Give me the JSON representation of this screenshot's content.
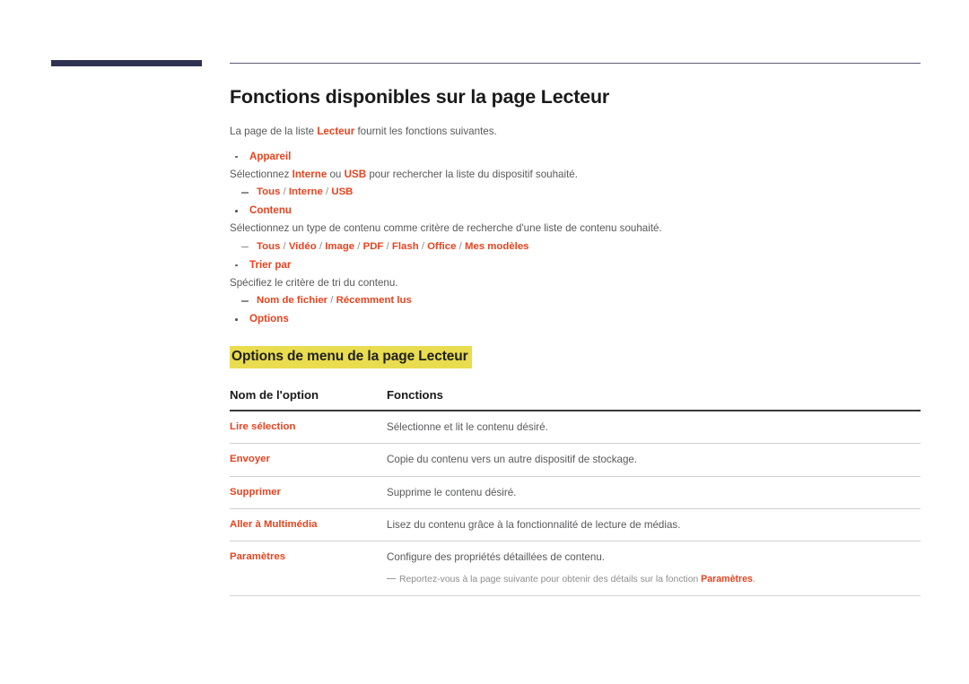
{
  "page": {
    "title": "Fonctions disponibles sur la page Lecteur",
    "intro": {
      "before": "La page de la liste ",
      "accent": "Lecteur",
      "after": " fournit les fonctions suivantes."
    }
  },
  "colors": {
    "accent": "#e8431f",
    "body_text": "#58595b",
    "heading": "#1a1a1a",
    "highlight": "#e9dc4e",
    "navy_bar": "#2e3250",
    "rule": "#5a5a72",
    "table_header_rule": "#3a3a3a",
    "table_row_rule": "#cfcfcf",
    "muted": "#8d8d8d"
  },
  "bullets": [
    {
      "label": "Appareil",
      "description_parts": [
        {
          "text": "Sélectionnez ",
          "style": "plain"
        },
        {
          "text": "Interne",
          "style": "accent"
        },
        {
          "text": " ou ",
          "style": "plain"
        },
        {
          "text": "USB",
          "style": "accent"
        },
        {
          "text": " pour rechercher la liste du dispositif souhaité.",
          "style": "plain"
        }
      ],
      "sub_items": [
        {
          "parts": [
            {
              "text": "Tous",
              "style": "accent"
            },
            {
              "text": " / ",
              "style": "sep"
            },
            {
              "text": "Interne",
              "style": "accent"
            },
            {
              "text": " / ",
              "style": "sep"
            },
            {
              "text": "USB",
              "style": "accent"
            }
          ]
        }
      ]
    },
    {
      "label": "Contenu",
      "description_parts": [
        {
          "text": "Sélectionnez un type de contenu comme critère de recherche d'une liste de contenu souhaité.",
          "style": "plain"
        }
      ],
      "sub_items": [
        {
          "parts": [
            {
              "text": "Tous",
              "style": "accent"
            },
            {
              "text": " / ",
              "style": "sep"
            },
            {
              "text": "Vidéo",
              "style": "accent"
            },
            {
              "text": " / ",
              "style": "sep"
            },
            {
              "text": "Image",
              "style": "accent"
            },
            {
              "text": " / ",
              "style": "sep"
            },
            {
              "text": "PDF",
              "style": "accent"
            },
            {
              "text": " / ",
              "style": "sep"
            },
            {
              "text": "Flash",
              "style": "accent"
            },
            {
              "text": " / ",
              "style": "sep"
            },
            {
              "text": "Office",
              "style": "accent"
            },
            {
              "text": " / ",
              "style": "sep"
            },
            {
              "text": "Mes modèles",
              "style": "accent"
            }
          ]
        }
      ]
    },
    {
      "label": "Trier par",
      "description_parts": [
        {
          "text": "Spécifiez le critère de tri du contenu.",
          "style": "plain"
        }
      ],
      "sub_items": [
        {
          "parts": [
            {
              "text": "Nom de fichier",
              "style": "accent"
            },
            {
              "text": " / ",
              "style": "sep"
            },
            {
              "text": "Récemment lus",
              "style": "accent"
            }
          ]
        }
      ]
    },
    {
      "label": "Options",
      "description_parts": [],
      "sub_items": []
    }
  ],
  "section": {
    "heading": "Options de menu de la page Lecteur"
  },
  "table": {
    "headers": [
      "Nom de l'option",
      "Fonctions"
    ],
    "rows": [
      {
        "name": "Lire sélection",
        "function": "Sélectionne et lit le contenu désiré.",
        "note": null
      },
      {
        "name": "Envoyer",
        "function": "Copie du contenu vers un autre dispositif de stockage.",
        "note": null
      },
      {
        "name": "Supprimer",
        "function": "Supprime le contenu désiré.",
        "note": null
      },
      {
        "name": "Aller à Multimédia",
        "function": "Lisez du contenu grâce à la fonctionnalité de lecture de médias.",
        "note": null
      },
      {
        "name": "Paramètres",
        "function": "Configure des propriétés détaillées de contenu.",
        "note": {
          "before": "Reportez-vous à la page suivante pour obtenir des détails sur la fonction ",
          "accent": "Paramètres",
          "after": "."
        }
      }
    ]
  }
}
